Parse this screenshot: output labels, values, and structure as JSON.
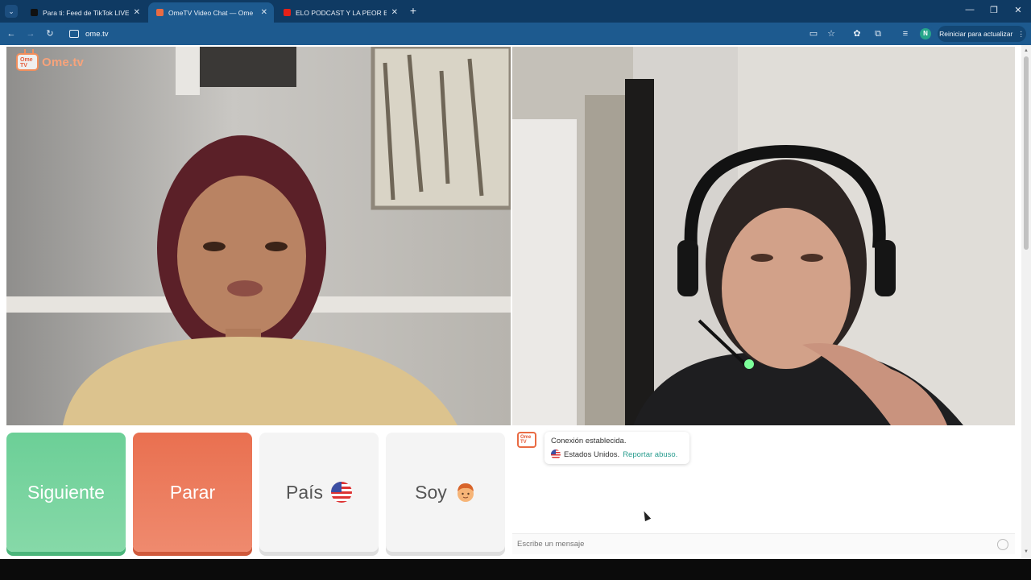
{
  "browser": {
    "tabs": [
      {
        "title": "Para ti: Feed de TikTok LIVE",
        "favicon_color": "#111111",
        "active": false
      },
      {
        "title": "OmeTV Video Chat — Ome",
        "favicon_color": "#e96b43",
        "active": true
      },
      {
        "title": "ELO PODCAST Y LA PEOR ENTR",
        "favicon_color": "#e62117",
        "active": false
      }
    ],
    "new_tab_icon": "+",
    "url": "ome.tv",
    "profile_initial": "N",
    "update_button": "Reiniciar para actualizar",
    "window_controls": [
      "—",
      "❐",
      "✕"
    ]
  },
  "site": {
    "logo_badge": "Ome TV",
    "logo_text": "Ome.tv"
  },
  "controls": {
    "next_label": "Siguiente",
    "stop_label": "Parar",
    "country_label": "País",
    "gender_label": "Soy"
  },
  "chat": {
    "avatar_text": "Ome TV",
    "line1": "Conexión establecida.",
    "country": "Estados Unidos.",
    "report_link": "Reportar abuso.",
    "input_placeholder": "Escribe un mensaje"
  },
  "colors": {
    "next": "#6ccf97",
    "stop": "#e97050",
    "link": "#2a9d8f",
    "brand": "#f28e5c"
  }
}
